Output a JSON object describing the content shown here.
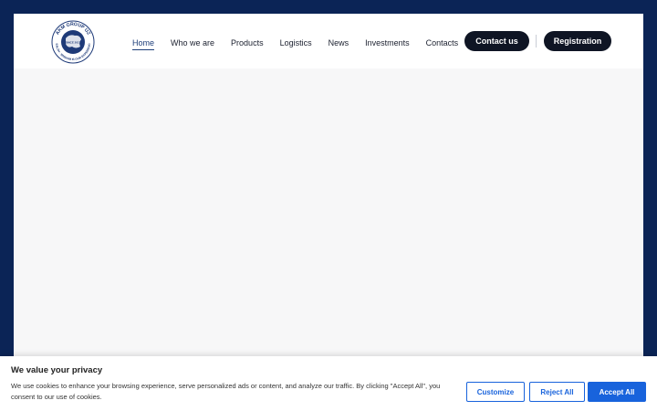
{
  "brand": {
    "logo_text_top": "AKM GROUP UZ",
    "logo_text_bottom": "HEALTH · WISDOM IS OUR EXPERIENCE",
    "logo_center": "SINCE 2017"
  },
  "nav": {
    "items": [
      {
        "label": "Home",
        "active": true
      },
      {
        "label": "Who we are",
        "active": false
      },
      {
        "label": "Products",
        "active": false
      },
      {
        "label": "Logistics",
        "active": false
      },
      {
        "label": "News",
        "active": false
      },
      {
        "label": "Investments",
        "active": false
      },
      {
        "label": "Contacts",
        "active": false
      }
    ]
  },
  "header": {
    "contact_label": "Contact us",
    "register_label": "Registration"
  },
  "cookie": {
    "title": "We value your privacy",
    "text": "We use cookies to enhance your browsing experience, serve personalized ads or content, and analyze our traffic. By clicking \"Accept All\", you consent to our use of cookies.",
    "customize_label": "Customize",
    "reject_label": "Reject All",
    "accept_label": "Accept All"
  },
  "colors": {
    "background": "#0b2456",
    "accent": "#1863dc",
    "dark_button": "#0f1524"
  }
}
